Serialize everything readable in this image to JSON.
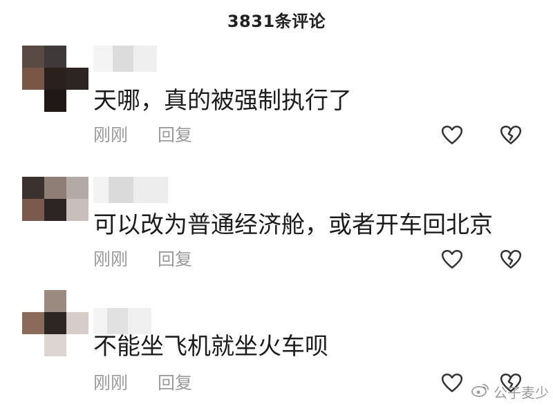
{
  "header": {
    "title": "3831条评论"
  },
  "comments": [
    {
      "text": "天哪，真的被强制执行了",
      "time": "刚刚",
      "reply_label": "回复"
    },
    {
      "text": "可以改为普通经济舱，或者开车回北京",
      "time": "刚刚",
      "reply_label": "回复"
    },
    {
      "text": "不能坐飞机就坐火车呗",
      "time": "刚刚",
      "reply_label": "回复"
    }
  ],
  "icons": {
    "like": "heart-outline-icon",
    "dislike": "broken-heart-icon",
    "watermark_logo": "weibo-logo-icon"
  },
  "watermark": {
    "text": "公子麦少"
  },
  "colors": {
    "text_primary": "#1c1c1c",
    "text_secondary": "#9a9a9a",
    "icon_stroke": "#333333",
    "background": "#ffffff"
  }
}
